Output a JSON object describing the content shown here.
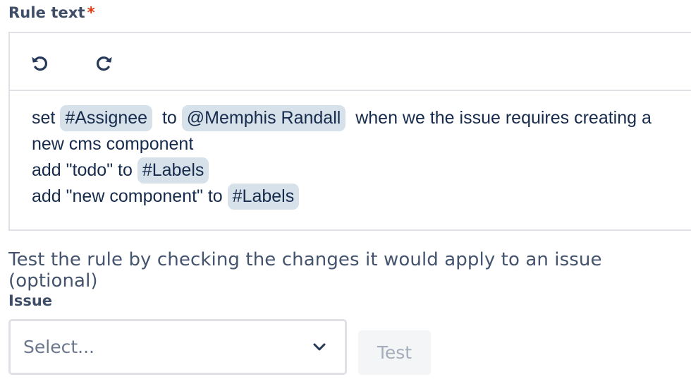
{
  "rule_field": {
    "label": "Rule text",
    "required_marker": "*"
  },
  "toolbar": {
    "undo_icon": "undo-icon",
    "redo_icon": "redo-icon"
  },
  "rule_lines": {
    "line1": {
      "t1": "set",
      "chip1": "#Assignee",
      "t2": "to",
      "chip2": "@Memphis Randall",
      "t3": "when we the issue requires creating a"
    },
    "line2": {
      "t1": "new cms component"
    },
    "line3": {
      "t1": "add \"todo\" to",
      "chip1": "#Labels"
    },
    "line4": {
      "t1": "add \"new component\" to",
      "chip1": "#Labels"
    }
  },
  "test_hint": "Test the rule by checking the changes it would apply to an issue (optional)",
  "issue_field": {
    "label": "Issue",
    "placeholder": "Select...",
    "chevron_icon": "chevron-down-icon"
  },
  "test_button": {
    "label": "Test",
    "disabled": true
  },
  "colors": {
    "chip_bg": "#d6e1ea",
    "label_text": "#3f4d66",
    "required": "#de350b",
    "border": "#dfe1e6"
  }
}
